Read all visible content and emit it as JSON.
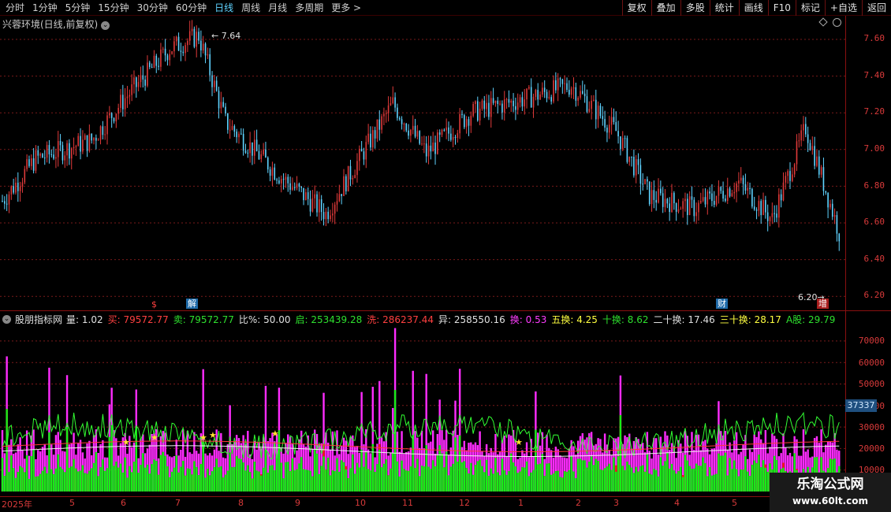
{
  "toolbar": {
    "periods": [
      "分时",
      "1分钟",
      "5分钟",
      "15分钟",
      "30分钟",
      "60分钟",
      "日线",
      "周线",
      "月线",
      "多周期",
      "更多 >"
    ],
    "active_period": "日线",
    "tools": [
      "复权",
      "叠加",
      "多股",
      "统计",
      "画线",
      "F10",
      "标记",
      "+自选",
      "返回"
    ]
  },
  "price_panel": {
    "title": "兴蓉环境(日线,前复权)",
    "high_label": "7.64",
    "low_label": "6.20"
  },
  "price_axis": [
    "7.60",
    "7.40",
    "7.20",
    "7.00",
    "6.80",
    "6.60",
    "6.40",
    "6.20"
  ],
  "event_tags": {
    "s": "$",
    "jie": "解",
    "cai": "财",
    "zeng": "增"
  },
  "indicator": {
    "name": "股朋指标网",
    "items": [
      {
        "label": "量: ",
        "value": "1.02",
        "color": "#e0e0e0"
      },
      {
        "label": "买: ",
        "value": "79572.77",
        "color": "#ff4040"
      },
      {
        "label": "卖: ",
        "value": "79572.77",
        "color": "#2ee02e"
      },
      {
        "label": "比%: ",
        "value": "50.00",
        "color": "#e0e0e0"
      },
      {
        "label": "启: ",
        "value": "253439.28",
        "color": "#2ee02e"
      },
      {
        "label": "洗: ",
        "value": "286237.44",
        "color": "#ff4040"
      },
      {
        "label": "异: ",
        "value": "258550.16",
        "color": "#e0e0e0"
      },
      {
        "label": "换: ",
        "value": "0.53",
        "color": "#ff3cff"
      },
      {
        "label": "五换: ",
        "value": "4.25",
        "color": "#ffff40"
      },
      {
        "label": "十换: ",
        "value": "8.62",
        "color": "#2ee02e"
      },
      {
        "label": "二十换: ",
        "value": "17.46",
        "color": "#e0e0e0"
      },
      {
        "label": "三十换: ",
        "value": "28.17",
        "color": "#ffff40"
      },
      {
        "label": "A股: ",
        "value": "29.79",
        "color": "#2ee02e"
      }
    ]
  },
  "vol_axis": [
    "70000",
    "60000",
    "50000",
    "40000",
    "30000",
    "20000",
    "10000"
  ],
  "vol_mark": "37337",
  "dates": [
    "2025年",
    "5",
    "6",
    "7",
    "8",
    "9",
    "10",
    "11",
    "12",
    "1",
    "2",
    "3",
    "4",
    "5"
  ],
  "watermark": {
    "title": "乐淘公式网",
    "url": "www.60lt.com"
  },
  "colors": {
    "up": "#e03a3a",
    "down": "#5fd3ff",
    "grid": "#7a1a1a",
    "vol_magenta": "#ff2cff",
    "vol_green": "#16ee16",
    "vol_red": "#ff1616"
  }
}
